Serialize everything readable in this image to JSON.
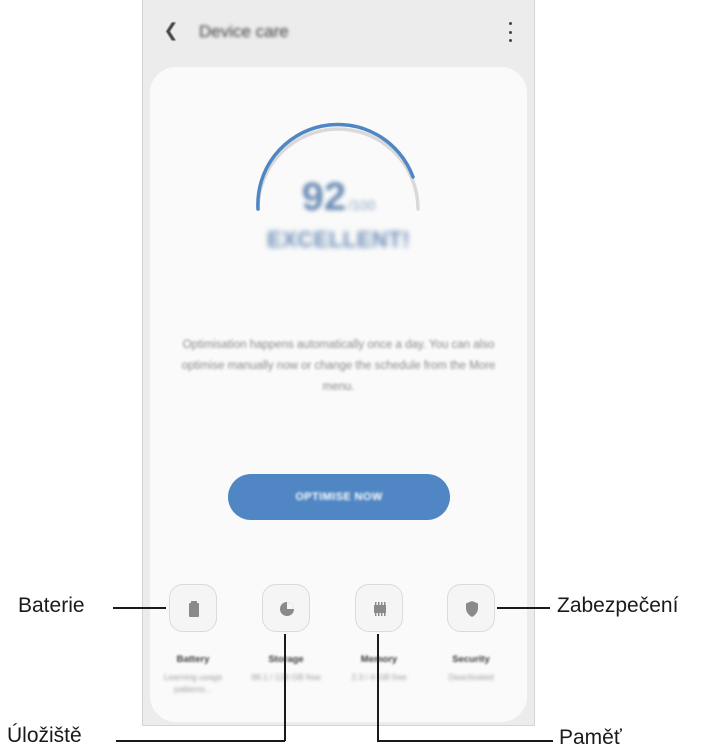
{
  "app": {
    "title": "Device care"
  },
  "score": {
    "value": "92",
    "max": "/100",
    "status": "EXCELLENT!"
  },
  "description": "Optimisation happens automatically once a day. You can also optimise manually now or change the schedule from the More menu.",
  "optimise_button": "OPTIMISE NOW",
  "tools": [
    {
      "label": "Battery",
      "sub": "Learning usage patterns..."
    },
    {
      "label": "Storage",
      "sub": "98.1 / 128 GB free"
    },
    {
      "label": "Memory",
      "sub": "2.3 / 4 GB free"
    },
    {
      "label": "Security",
      "sub": "Deactivated"
    }
  ],
  "callouts": {
    "battery": "Baterie",
    "storage": "Úložiště",
    "memory": "Paměť",
    "security": "Zabezpečení"
  },
  "colors": {
    "accent": "#4f86c3",
    "gauge_active": "#4f86c3",
    "gauge_track": "#d9d9d9"
  }
}
